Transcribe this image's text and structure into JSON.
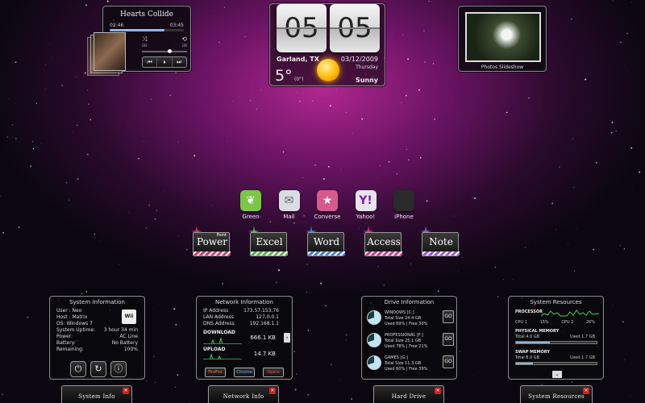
{
  "music": {
    "song": "Hearts Collide",
    "elapsed": "02:46",
    "total": "03:45",
    "progress": 0.74,
    "volume": 0.62,
    "shuffle_state": "ON",
    "repeat_state": "ON",
    "icons": [
      "shuffle-icon",
      "repeat-icon",
      "prev-icon",
      "pause-icon",
      "next-icon"
    ]
  },
  "clock": {
    "hour": "05",
    "minute": "05"
  },
  "weather": {
    "city": "Garland, TX",
    "date": "03/12/2009",
    "day": "Thursday",
    "temp": "5°",
    "feels": "(0°)",
    "condition": "Sunny",
    "icon": "sun-icon"
  },
  "photos": {
    "caption": "Photos Slideshow"
  },
  "apps": [
    {
      "label": "Green",
      "color": "#7cc44a"
    },
    {
      "label": "Mail",
      "color": "#d9dde3"
    },
    {
      "label": "Converse",
      "color": "#d65a8e"
    },
    {
      "label": "Yahoo!",
      "color": "#e8e4ee"
    },
    {
      "label": "iPhone",
      "color": "#2a2a2a"
    }
  ],
  "office": [
    {
      "label": "Power",
      "sup": "Point",
      "stripe": "#d23a6a"
    },
    {
      "label": "Excel",
      "sup": "",
      "stripe": "#5fb04a"
    },
    {
      "label": "Word",
      "sup": "",
      "stripe": "#4a7ed8"
    },
    {
      "label": "Access",
      "sup": "",
      "stripe": "#d03a8a"
    },
    {
      "label": "Note",
      "sup": "",
      "stripe": "#9a5ad8"
    }
  ],
  "sysinfo": {
    "title": "System Information",
    "logo": "Wii",
    "rows": [
      {
        "k": "User : Neo",
        "v": ""
      },
      {
        "k": "Host : Matrix",
        "v": ""
      },
      {
        "k": "OS: Windows 7",
        "v": ""
      },
      {
        "k": "System Uptime:",
        "v": "3 hour 34 min"
      },
      {
        "k": "Power:",
        "v": "AC Line"
      },
      {
        "k": "Battery:",
        "v": "No Battery"
      },
      {
        "k": "Remaining:",
        "v": "100%"
      }
    ]
  },
  "netinfo": {
    "title": "Network Information",
    "rows": [
      {
        "k": "IP Address",
        "v": "173.57.153.76"
      },
      {
        "k": "LAN Address",
        "v": "127.0.0.1"
      },
      {
        "k": "DNS Address",
        "v": "192.168.1.1"
      }
    ],
    "download_label": "DOWNLOAD",
    "download": "666.1 KB",
    "upload_label": "UPLOAD",
    "upload": "14.7 KB",
    "browsers": [
      "FireFox",
      "Chrome",
      "Opera"
    ]
  },
  "drive": {
    "title": "Drive Information",
    "go": "GO",
    "drives": [
      {
        "name": "WINDOWS [C:]",
        "total": "Total Size  24.4 GB",
        "used": "Used 69%  |  Free 30%"
      },
      {
        "name": "PROFESSIONAL [F:]",
        "total": "Total Size  25.1 GB",
        "used": "Used 78%  |  Free 21%"
      },
      {
        "name": "GAMES [G:]",
        "total": "Total Size  11.3 GB",
        "used": "Used 60%  |  Free 39%"
      }
    ]
  },
  "sysres": {
    "title": "System Resources",
    "processor": "PROCESSOR",
    "cpu1": "CPU 1",
    "cpu1_val": "15%",
    "cpu2": "CPU 2",
    "cpu2_val": "26%",
    "physical": "PHYSICAL MEMORY",
    "phys_total": "Total 4.0 GB",
    "phys_used": "Used 1.7 GB",
    "phys_frac": 0.42,
    "swap": "SWAP MEMORY",
    "swap_total": "Total 8.0 GB",
    "swap_used": "Used 1.7 GB",
    "swap_frac": 0.21
  },
  "tabs": [
    "System Info",
    "Network Info",
    "Hard Drive",
    "System Resources"
  ]
}
